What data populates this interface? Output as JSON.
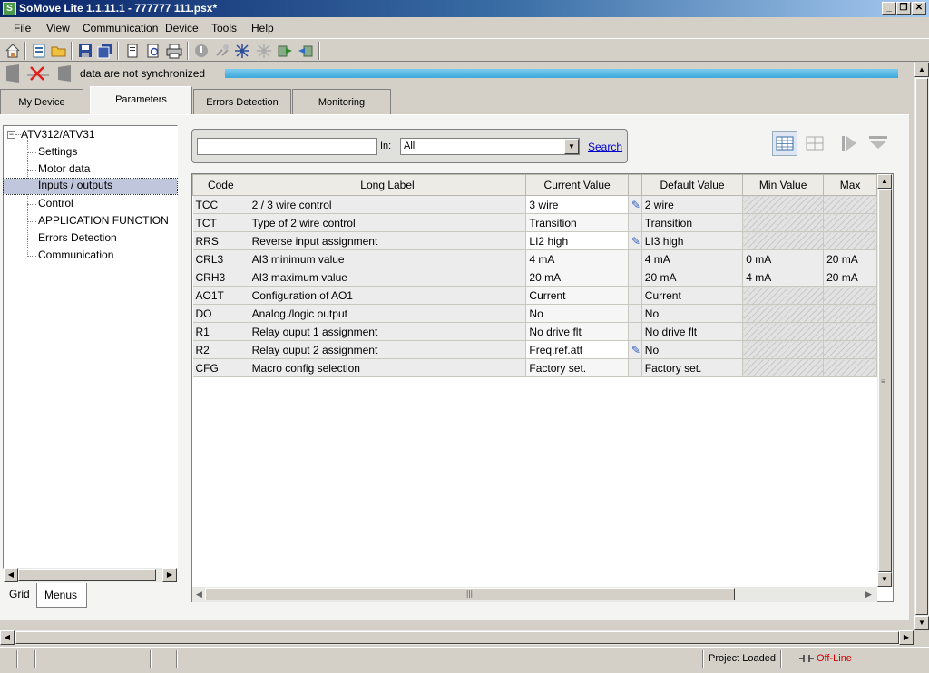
{
  "window": {
    "title": "SoMove Lite 1.1.11.1 - 777777 111.psx*"
  },
  "menu": [
    "File",
    "View",
    "Communication",
    "Device",
    "Tools",
    "Help"
  ],
  "sync": {
    "status_text": "data are not synchronized"
  },
  "tabs": [
    "My Device",
    "Parameters",
    "Errors Detection",
    "Monitoring"
  ],
  "tree": {
    "root": "ATV312/ATV31",
    "items": [
      "Settings",
      "Motor data",
      "Inputs / outputs",
      "Control",
      "APPLICATION FUNCTION",
      "Errors Detection",
      "Communication"
    ],
    "selected": "Inputs / outputs"
  },
  "search": {
    "in_label": "In:",
    "in_value": "All",
    "button_label": "Search",
    "query": ""
  },
  "grid": {
    "columns": [
      "Code",
      "Long Label",
      "Current Value",
      "Default Value",
      "Min Value",
      "Max"
    ],
    "rows": [
      {
        "code": "TCC",
        "label": "2 / 3 wire control",
        "current": "3 wire",
        "edited": true,
        "default": "2 wire",
        "min": "",
        "max": ""
      },
      {
        "code": "TCT",
        "label": "Type of 2 wire control",
        "current": "Transition",
        "edited": false,
        "default": "Transition",
        "min": "",
        "max": ""
      },
      {
        "code": "RRS",
        "label": "Reverse input assignment",
        "current": "LI2 high",
        "edited": true,
        "default": "LI3 high",
        "min": "",
        "max": ""
      },
      {
        "code": "CRL3",
        "label": "AI3 minimum value",
        "current": "4 mA",
        "edited": false,
        "default": "4 mA",
        "min": "0 mA",
        "max": "20 mA"
      },
      {
        "code": "CRH3",
        "label": "AI3 maximum value",
        "current": "20 mA",
        "edited": false,
        "default": "20 mA",
        "min": "4 mA",
        "max": "20 mA"
      },
      {
        "code": "AO1T",
        "label": "Configuration of AO1",
        "current": "Current",
        "edited": false,
        "default": "Current",
        "min": "",
        "max": ""
      },
      {
        "code": "DO",
        "label": "Analog./logic output",
        "current": "No",
        "edited": false,
        "default": "No",
        "min": "",
        "max": ""
      },
      {
        "code": "R1",
        "label": "Relay ouput 1 assignment",
        "current": "No drive flt",
        "edited": false,
        "default": "No drive flt",
        "min": "",
        "max": ""
      },
      {
        "code": "R2",
        "label": "Relay ouput 2 assignment",
        "current": "Freq.ref.att",
        "edited": true,
        "default": "No",
        "min": "",
        "max": ""
      },
      {
        "code": "CFG",
        "label": "Macro config selection",
        "current": "Factory set.",
        "edited": false,
        "default": "Factory set.",
        "min": "",
        "max": ""
      }
    ]
  },
  "bottom_tabs": [
    "Grid",
    "Menus"
  ],
  "status": {
    "project": "Project Loaded",
    "connection": "Off-Line"
  },
  "colors": {
    "accent_progress": "#3aa8d8",
    "offline_text": "#cc0000",
    "link": "#0000cc",
    "title_bar": "#0a246a"
  }
}
